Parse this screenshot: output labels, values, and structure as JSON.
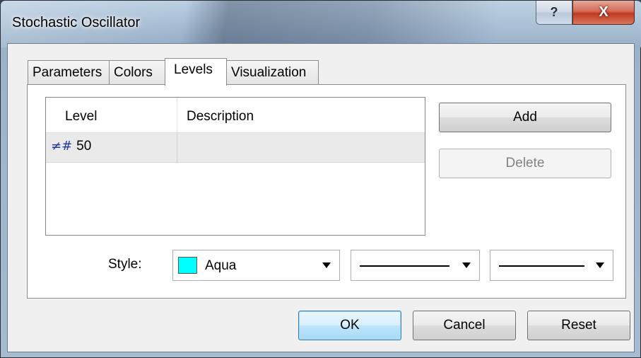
{
  "window": {
    "title": "Stochastic Oscillator",
    "help_glyph": "?",
    "close_glyph": "X"
  },
  "tabs": [
    {
      "label": "Parameters",
      "active": false
    },
    {
      "label": "Colors",
      "active": false
    },
    {
      "label": "Levels",
      "active": true
    },
    {
      "label": "Visualization",
      "active": false
    }
  ],
  "levels_table": {
    "columns": [
      "Level",
      "Description"
    ],
    "rows": [
      {
        "icon": "level-line-icon",
        "level": "50",
        "description": ""
      }
    ]
  },
  "buttons": {
    "add": "Add",
    "delete": "Delete",
    "ok": "OK",
    "cancel": "Cancel",
    "reset": "Reset"
  },
  "style": {
    "label": "Style:",
    "color_name": "Aqua",
    "color_hex": "#00ffff",
    "line_style": "solid",
    "line_width": "thin"
  }
}
